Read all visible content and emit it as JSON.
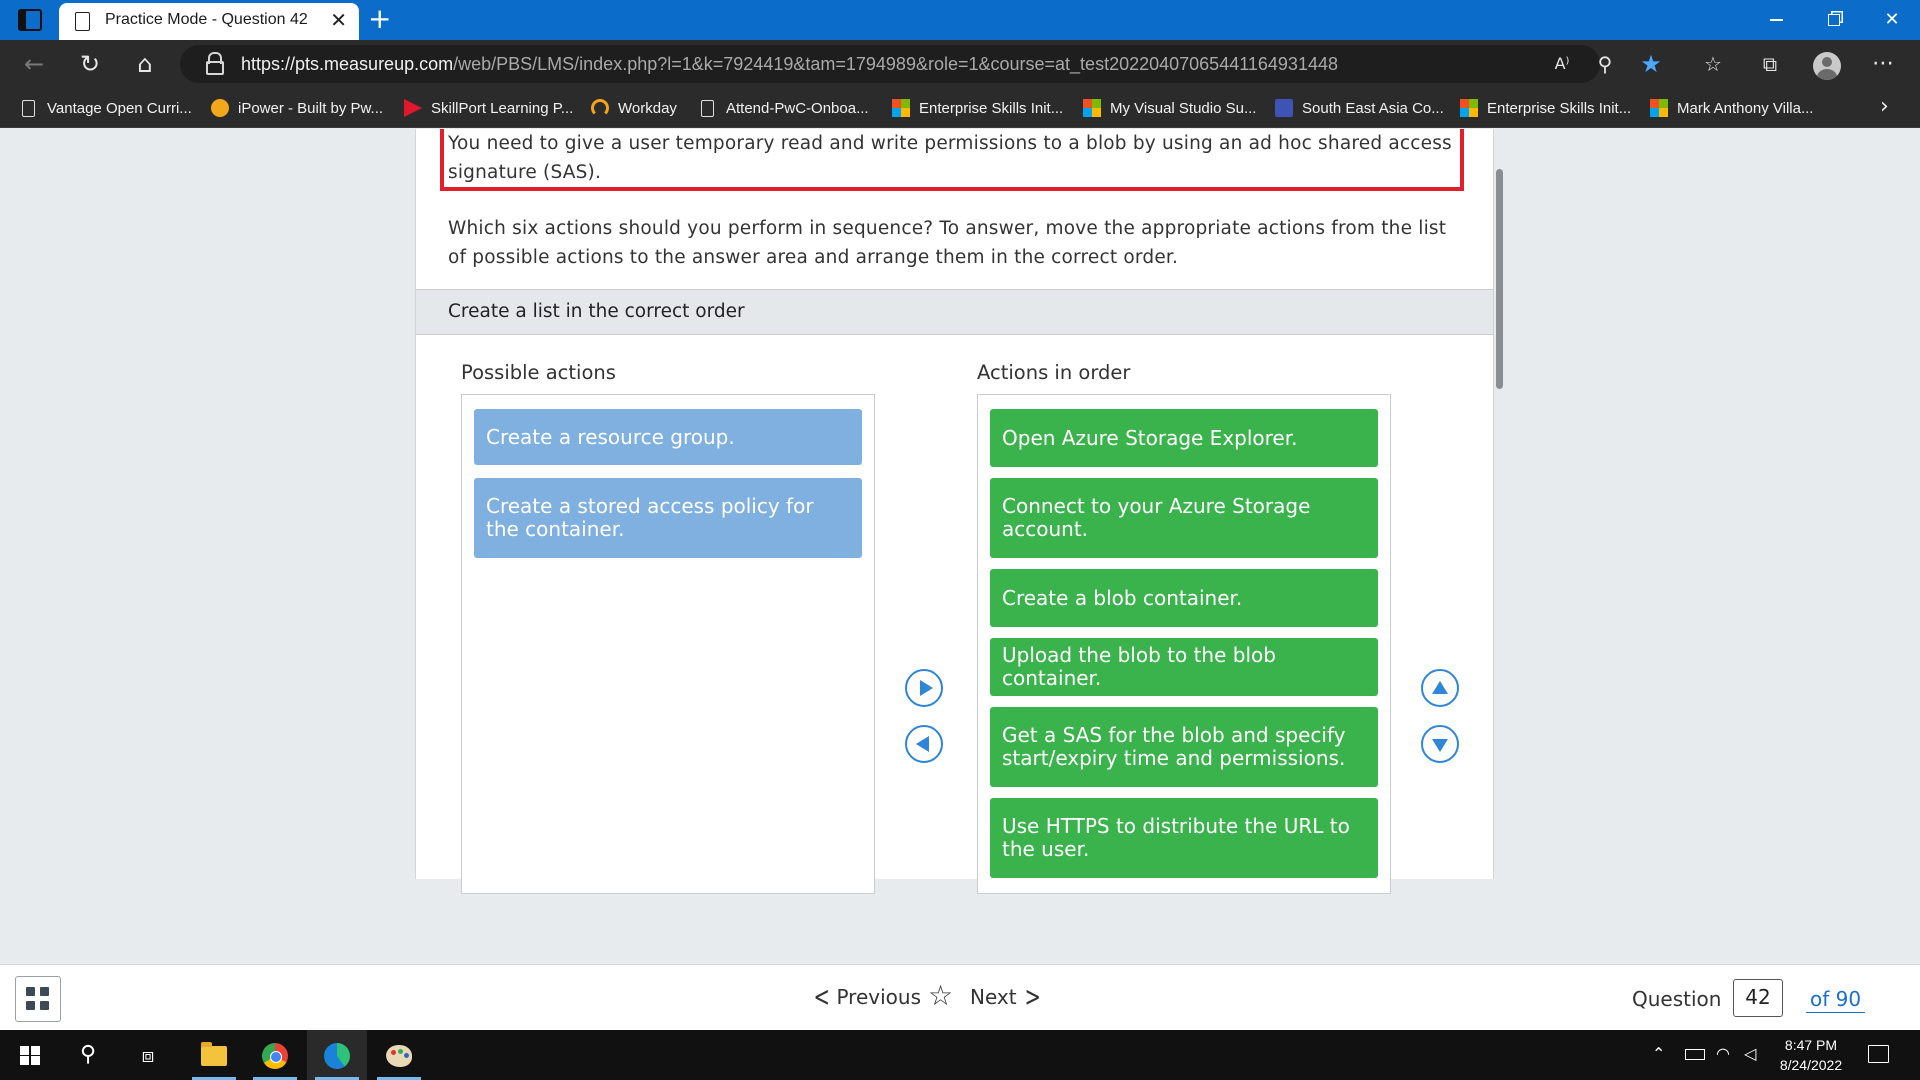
{
  "browser": {
    "tab_title": "Practice Mode - Question 42",
    "tab_close": "✕",
    "new_tab": "+",
    "url_host": "https://pts.measureup.com",
    "url_path": "/web/PBS/LMS/index.php?l=1&k=7924419&tam=1794989&role=1&course=at_test20220407065441164931448",
    "read_aloud_label": "A⁾",
    "more": "⋯",
    "bookmarks": [
      {
        "label": "Vantage Open Curri...",
        "icon": "doc-icon"
      },
      {
        "label": "iPower - Built by Pw...",
        "icon": "ipower-icon"
      },
      {
        "label": "SkillPort Learning P...",
        "icon": "skillport-icon"
      },
      {
        "label": "Workday",
        "icon": "workday-icon"
      },
      {
        "label": "Attend-PwC-Onboa...",
        "icon": "doc-icon"
      },
      {
        "label": "Enterprise Skills Init...",
        "icon": "microsoft-icon"
      },
      {
        "label": "My Visual Studio Su...",
        "icon": "microsoft-icon"
      },
      {
        "label": "South East Asia Co...",
        "icon": "calendar-icon"
      },
      {
        "label": "Enterprise Skills Init...",
        "icon": "microsoft-icon"
      },
      {
        "label": "Mark Anthony Villa...",
        "icon": "microsoft-icon"
      }
    ]
  },
  "question": {
    "stem": "You need to give a user temporary read and write permissions to a blob by using an ad hoc shared access signature (SAS).",
    "instructions": "Which six actions should you perform in sequence? To answer, move the appropriate actions from the list of possible actions to the answer area and arrange them in the correct order.",
    "section_title": "Create a list in the correct order",
    "possible_title": "Possible actions",
    "order_title": "Actions in order",
    "possible_actions": [
      "Create a resource group.",
      "Create a stored access policy for the container."
    ],
    "actions_in_order": [
      "Open Azure Storage Explorer.",
      "Connect to your Azure Storage account.",
      "Create a blob container.",
      "Upload the blob to the blob container.",
      "Get a SAS for the blob and specify start/expiry time and permissions.",
      "Use HTTPS to distribute the URL to the user."
    ]
  },
  "footer": {
    "previous_label": "Previous",
    "next_label": "Next",
    "question_label": "Question",
    "question_number": "42",
    "question_total": "of 90"
  },
  "taskbar": {
    "time": "8:47 PM",
    "date": "8/24/2022"
  },
  "colors": {
    "browser_blue": "#0b6cc9",
    "possible_item": "#7fb0e0",
    "ordered_item": "#3bb34d",
    "highlight_border": "#e21f2a",
    "arrow_blue": "#2f86d6"
  }
}
